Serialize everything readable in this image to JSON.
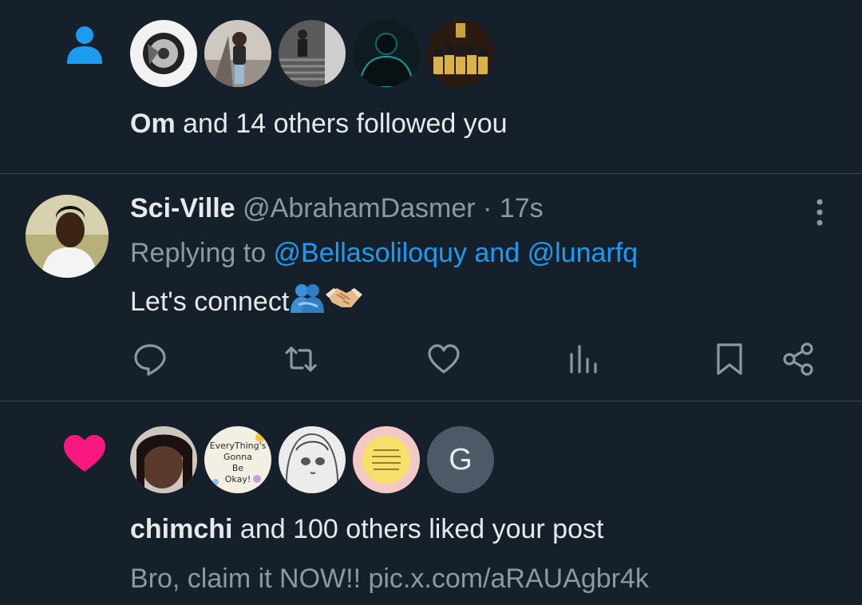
{
  "follow_notification": {
    "icon": "person-icon",
    "accent": "#1d9bf0",
    "actor": "Om",
    "summary_rest": " and 14 others followed you",
    "avatars": [
      "avatar-1",
      "avatar-2",
      "avatar-3",
      "avatar-4",
      "avatar-5"
    ]
  },
  "reply_notification": {
    "display_name": "Sci-Ville",
    "handle": "@AbrahamDasmer",
    "separator": " · ",
    "timestamp": "17s",
    "replying_prefix": "Replying to ",
    "reply_user_1": "@Bellasoliloquy",
    "reply_joiner": " and ",
    "reply_user_2": "@lunarfq",
    "text": "Let's connect",
    "emojis": [
      "people-hugging-emoji",
      "handshake-emoji"
    ],
    "actions": [
      "reply-icon",
      "retweet-icon",
      "like-icon",
      "views-icon",
      "bookmark-icon",
      "share-icon"
    ]
  },
  "like_notification": {
    "icon": "heart-icon",
    "accent": "#f91880",
    "actor": "chimchi",
    "summary_rest": " and 100 others liked your post",
    "post_text": "Bro, claim it NOW!! pic.x.com/aRAUAgbr4k",
    "avatar_letter": "G"
  },
  "colors": {
    "background": "#15202b",
    "divider": "#38444d",
    "muted": "#8b98a5",
    "link": "#1d9bf0"
  }
}
